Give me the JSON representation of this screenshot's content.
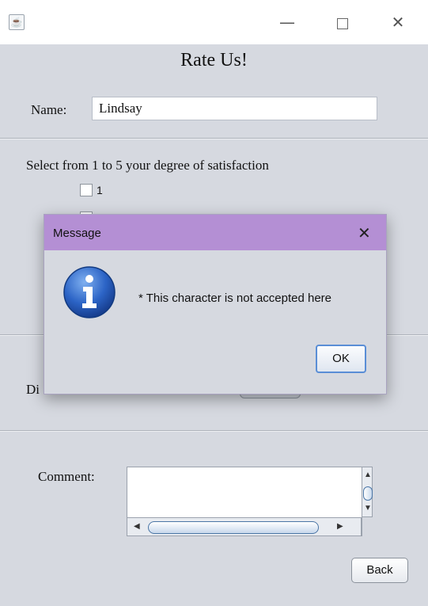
{
  "window": {
    "title": ""
  },
  "form": {
    "title": "Rate Us!",
    "name_label": "Name:",
    "name_value": "Lindsay",
    "select_label": "Select from 1 to 5 your degree of satisfaction",
    "checkbox_1": "1",
    "di_label_partial": "Di",
    "comment_label": "Comment:",
    "comment_value": "",
    "back_button": "Back"
  },
  "dialog": {
    "title": "Message",
    "message": "* This character is not accepted here",
    "ok_button": "OK",
    "icon": "info-icon"
  },
  "colors": {
    "dialog_titlebar": "#b48fd4",
    "panel_background": "#d6d9e0"
  }
}
